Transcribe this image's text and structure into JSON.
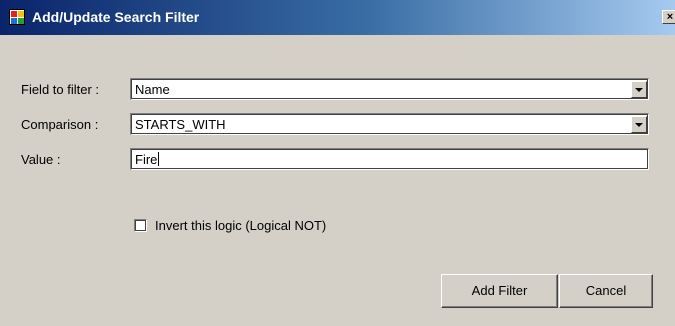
{
  "window": {
    "title": "Add/Update Search Filter",
    "close_glyph": "×"
  },
  "form": {
    "field": {
      "label": "Field to filter :",
      "value": "Name"
    },
    "comparison": {
      "label": "Comparison :",
      "value": "STARTS_WITH"
    },
    "value": {
      "label": "Value :",
      "value": "Fire"
    },
    "invert": {
      "label": "Invert this logic (Logical NOT)",
      "checked": false
    }
  },
  "buttons": {
    "add_filter": "Add Filter",
    "cancel": "Cancel"
  },
  "icons": {
    "app": "app-icon",
    "close": "close-icon",
    "dropdown": "chevron-down-icon"
  }
}
